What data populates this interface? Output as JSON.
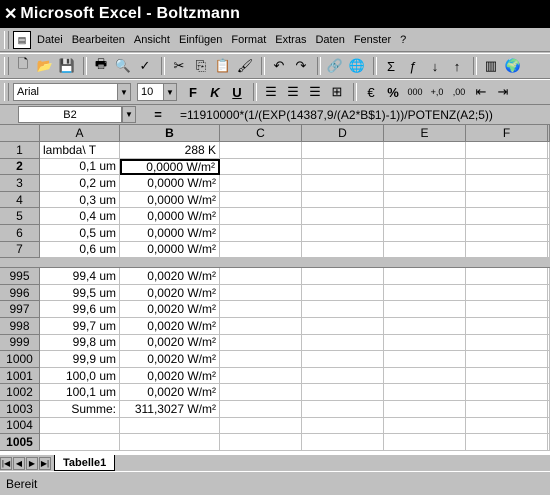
{
  "window": {
    "title": "Microsoft Excel - Boltzmann"
  },
  "menu": [
    "Datei",
    "Bearbeiten",
    "Ansicht",
    "Einfügen",
    "Format",
    "Extras",
    "Daten",
    "Fenster",
    "?"
  ],
  "toolbar1": {
    "icons": [
      "new-icon",
      "open-icon",
      "save-icon",
      "print-icon",
      "print-preview-icon",
      "spelling-icon",
      "cut-icon",
      "copy-icon",
      "paste-icon",
      "format-painter-icon",
      "undo-icon",
      "redo-icon",
      "hyperlink-icon",
      "web-toolbar-icon",
      "autosum-icon",
      "function-icon",
      "sort-ascending-icon",
      "sort-descending-icon",
      "chart-wizard-icon",
      "map-icon"
    ],
    "glyphs": [
      "🗋",
      "📂",
      "💾",
      "🖶",
      "🔍",
      "✓",
      "✂",
      "⎘",
      "📋",
      "🖌",
      "↶",
      "↷",
      "🔗",
      "🌐",
      "Σ",
      "ƒ",
      "↓",
      "↑",
      "▥",
      "🌍"
    ]
  },
  "toolbar2": {
    "font": "Arial",
    "size": "10",
    "bold": "F",
    "italic": "K",
    "underline": "U",
    "percent": "%",
    "thousands": "000",
    "inc_decimal": "+,0",
    "dec_decimal": ",00"
  },
  "formula_bar": {
    "name_box": "B2",
    "eq": "=",
    "formula": "=11910000*(1/(EXP(14387,9/(A2*B$1)-1))/POTENZ(A2;5))"
  },
  "columns": [
    "A",
    "B",
    "C",
    "D",
    "E",
    "F"
  ],
  "top_rows": [
    {
      "n": "1",
      "a": "lambda\\  T",
      "b": "288 K"
    },
    {
      "n": "2",
      "a": "0,1 um",
      "b": "0,0000 W/m²"
    },
    {
      "n": "3",
      "a": "0,2 um",
      "b": "0,0000 W/m²"
    },
    {
      "n": "4",
      "a": "0,3 um",
      "b": "0,0000 W/m²"
    },
    {
      "n": "5",
      "a": "0,4 um",
      "b": "0,0000 W/m²"
    },
    {
      "n": "6",
      "a": "0,5 um",
      "b": "0,0000 W/m²"
    },
    {
      "n": "7",
      "a": "0,6 um",
      "b": "0,0000 W/m²"
    }
  ],
  "bottom_rows": [
    {
      "n": "995",
      "a": "99,4 um",
      "b": "0,0020 W/m²"
    },
    {
      "n": "996",
      "a": "99,5 um",
      "b": "0,0020 W/m²"
    },
    {
      "n": "997",
      "a": "99,6 um",
      "b": "0,0020 W/m²"
    },
    {
      "n": "998",
      "a": "99,7 um",
      "b": "0,0020 W/m²"
    },
    {
      "n": "999",
      "a": "99,8 um",
      "b": "0,0020 W/m²"
    },
    {
      "n": "1000",
      "a": "99,9 um",
      "b": "0,0020 W/m²"
    },
    {
      "n": "1001",
      "a": "100,0 um",
      "b": "0,0020 W/m²"
    },
    {
      "n": "1002",
      "a": "100,1 um",
      "b": "0,0020 W/m²"
    },
    {
      "n": "1003",
      "a": "Summe:",
      "b": "311,3027 W/m²"
    },
    {
      "n": "1004",
      "a": "",
      "b": ""
    },
    {
      "n": "1005",
      "a": "",
      "b": ""
    }
  ],
  "sheet_tab": "Tabelle1",
  "status": "Bereit"
}
